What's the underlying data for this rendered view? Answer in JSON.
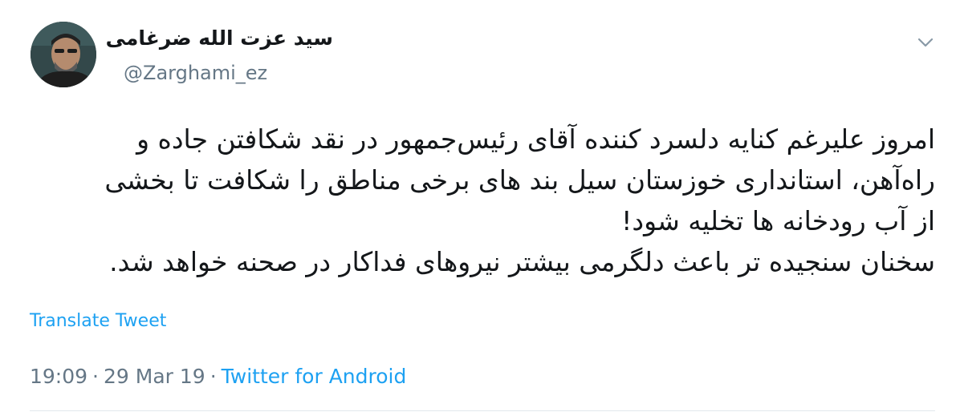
{
  "author": {
    "display_name": "سید عزت الله ضرغامی",
    "handle": "@Zarghami_ez",
    "avatar_icon": "user-avatar-photo"
  },
  "tweet": {
    "text": "امروز علیرغم کنایه دلسرد کننده آقای رئیس‌جمهور در نقد شکافتن جاده و\nراه‌آهن، استانداری خوزستان سیل بند های برخی مناطق را شکافت تا بخشی\nاز آب رودخانه ها تخلیه شود!\nسخنان سنجیده تر باعث دلگرمی بیشتر نیروهای فداکار در صحنه خواهد شد.",
    "translate_label": "Translate Tweet",
    "time": "19:09",
    "date": "29 Mar 19",
    "separator": "·",
    "source": "Twitter for Android"
  },
  "colors": {
    "link": "#1da1f2",
    "muted": "#657786",
    "text": "#14171a",
    "divider": "#e1e8ed"
  },
  "icons": {
    "menu": "chevron-down-icon"
  }
}
